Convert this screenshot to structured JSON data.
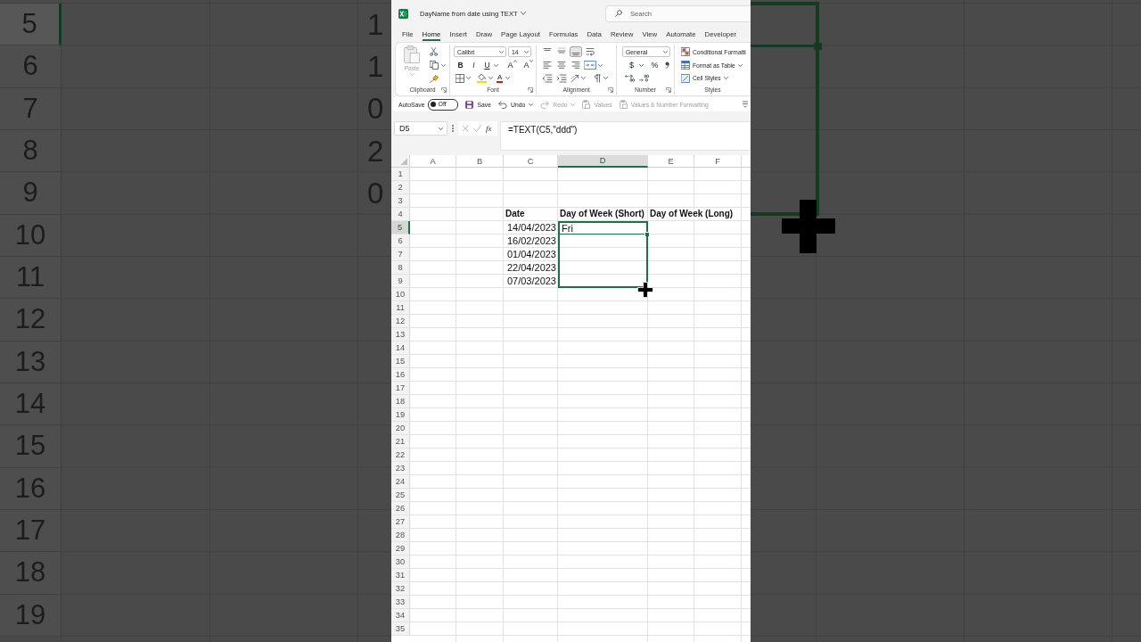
{
  "backdrop_left": {
    "row_headers": [
      {
        "label": "5",
        "selected": true
      },
      {
        "label": "6",
        "selected": false
      },
      {
        "label": "7",
        "selected": false
      },
      {
        "label": "8",
        "selected": false
      },
      {
        "label": "9",
        "selected": false
      },
      {
        "label": "10",
        "selected": false
      },
      {
        "label": "11",
        "selected": false
      },
      {
        "label": "12",
        "selected": false
      },
      {
        "label": "13",
        "selected": false
      },
      {
        "label": "14",
        "selected": false
      },
      {
        "label": "15",
        "selected": false
      },
      {
        "label": "16",
        "selected": false
      },
      {
        "label": "17",
        "selected": false
      },
      {
        "label": "18",
        "selected": false
      },
      {
        "label": "19",
        "selected": false
      }
    ],
    "cell_fragments": [
      "1",
      "1",
      "0",
      "2",
      "0"
    ]
  },
  "title_bar": {
    "file_name": "DayName from date using TEXT",
    "search_placeholder": "Search"
  },
  "ribbon_tabs": [
    {
      "label": "File",
      "selected": false
    },
    {
      "label": "Home",
      "selected": true
    },
    {
      "label": "Insert",
      "selected": false
    },
    {
      "label": "Draw",
      "selected": false
    },
    {
      "label": "Page Layout",
      "selected": false
    },
    {
      "label": "Formulas",
      "selected": false
    },
    {
      "label": "Data",
      "selected": false
    },
    {
      "label": "Review",
      "selected": false
    },
    {
      "label": "View",
      "selected": false
    },
    {
      "label": "Automate",
      "selected": false
    },
    {
      "label": "Developer",
      "selected": false
    }
  ],
  "ribbon": {
    "clipboard": {
      "paste_label": "Paste",
      "paste_disabled": true,
      "group_label": "Clipboard"
    },
    "font": {
      "font_name": "Calibri",
      "font_size": "14",
      "style_buttons": [
        {
          "kind": "bold",
          "label": "B"
        },
        {
          "kind": "italic",
          "label": "I"
        },
        {
          "kind": "underline",
          "label": "U"
        }
      ],
      "size_buttons": [
        {
          "kind": "grow",
          "label": "A"
        },
        {
          "kind": "shrink",
          "label": "A"
        }
      ],
      "font_color_label": "A",
      "group_label": "Font"
    },
    "alignment": {
      "vertical": [
        {
          "kind": "top",
          "selected": false
        },
        {
          "kind": "middle",
          "selected": false
        },
        {
          "kind": "bottom",
          "selected": true
        }
      ],
      "horizontal": [
        {
          "kind": "left",
          "selected": false
        },
        {
          "kind": "center",
          "selected": false
        },
        {
          "kind": "right",
          "selected": false
        }
      ],
      "group_label": "Alignment"
    },
    "number": {
      "format": "General",
      "currency_label": "$",
      "percent_label": "%",
      "group_label": "Number"
    },
    "styles": {
      "items": [
        {
          "kind": "conditional",
          "label": "Conditional Formatti"
        },
        {
          "kind": "table",
          "label": "Format as Table"
        },
        {
          "kind": "cell_styles",
          "label": "Cell Styles"
        }
      ],
      "group_label": "Styles"
    }
  },
  "quick_access": {
    "autosave_label": "AutoSave",
    "autosave_on": false,
    "autosave_state": "Off",
    "commands": [
      {
        "kind": "save",
        "label": "Save",
        "disabled": false
      },
      {
        "kind": "undo",
        "label": "Undo",
        "disabled": false
      },
      {
        "kind": "redo",
        "label": "Redo",
        "disabled": true
      },
      {
        "kind": "values",
        "label": "Values",
        "disabled": true
      },
      {
        "kind": "values_number",
        "label": "Values & Number Formatting",
        "disabled": true
      }
    ]
  },
  "formula_bar": {
    "name_box": "D5",
    "function_label": "fx",
    "formula": "=TEXT(C5,\"ddd\")"
  },
  "sheet": {
    "columns": [
      {
        "label": "A",
        "selected": false
      },
      {
        "label": "B",
        "selected": false
      },
      {
        "label": "C",
        "selected": false
      },
      {
        "label": "D",
        "selected": true
      },
      {
        "label": "E",
        "selected": false
      },
      {
        "label": "F",
        "selected": false
      }
    ],
    "rows": [
      {
        "label": "1",
        "kind": "empty",
        "selected": false,
        "in_fill_range": false
      },
      {
        "label": "2",
        "kind": "empty",
        "selected": false,
        "in_fill_range": false
      },
      {
        "label": "3",
        "kind": "empty",
        "selected": false,
        "in_fill_range": false
      },
      {
        "label": "4",
        "kind": "header",
        "selected": false,
        "in_fill_range": false,
        "date": "Date",
        "day_short": "Day of Week (Short)",
        "day_long": "Day of Week (Long)"
      },
      {
        "label": "5",
        "kind": "data",
        "selected": true,
        "in_fill_range": true,
        "date": "14/04/2023",
        "day_short": "Fri"
      },
      {
        "label": "6",
        "kind": "data",
        "selected": false,
        "in_fill_range": true,
        "date": "16/02/2023"
      },
      {
        "label": "7",
        "kind": "data",
        "selected": false,
        "in_fill_range": true,
        "date": "01/04/2023"
      },
      {
        "label": "8",
        "kind": "data",
        "selected": false,
        "in_fill_range": true,
        "date": "22/04/2023"
      },
      {
        "label": "9",
        "kind": "data",
        "selected": false,
        "in_fill_range": true,
        "date": "07/03/2023"
      },
      {
        "label": "10",
        "kind": "empty",
        "selected": false,
        "in_fill_range": false
      },
      {
        "label": "11",
        "kind": "empty",
        "selected": false,
        "in_fill_range": false
      },
      {
        "label": "12",
        "kind": "empty",
        "selected": false,
        "in_fill_range": false
      },
      {
        "label": "13",
        "kind": "empty",
        "selected": false,
        "in_fill_range": false
      },
      {
        "label": "14",
        "kind": "empty",
        "selected": false,
        "in_fill_range": false
      },
      {
        "label": "15",
        "kind": "empty",
        "selected": false,
        "in_fill_range": false
      },
      {
        "label": "16",
        "kind": "empty",
        "selected": false,
        "in_fill_range": false
      },
      {
        "label": "17",
        "kind": "empty",
        "selected": false,
        "in_fill_range": false
      },
      {
        "label": "18",
        "kind": "empty",
        "selected": false,
        "in_fill_range": false
      },
      {
        "label": "19",
        "kind": "empty",
        "selected": false,
        "in_fill_range": false
      },
      {
        "label": "20",
        "kind": "empty",
        "selected": false,
        "in_fill_range": false
      },
      {
        "label": "21",
        "kind": "empty",
        "selected": false,
        "in_fill_range": false
      },
      {
        "label": "22",
        "kind": "empty",
        "selected": false,
        "in_fill_range": false
      },
      {
        "label": "23",
        "kind": "empty",
        "selected": false,
        "in_fill_range": false
      },
      {
        "label": "24",
        "kind": "empty",
        "selected": false,
        "in_fill_range": false
      },
      {
        "label": "25",
        "kind": "empty",
        "selected": false,
        "in_fill_range": false
      },
      {
        "label": "26",
        "kind": "empty",
        "selected": false,
        "in_fill_range": false
      },
      {
        "label": "27",
        "kind": "empty",
        "selected": false,
        "in_fill_range": false
      },
      {
        "label": "28",
        "kind": "empty",
        "selected": false,
        "in_fill_range": false
      },
      {
        "label": "29",
        "kind": "empty",
        "selected": false,
        "in_fill_range": false
      },
      {
        "label": "30",
        "kind": "empty",
        "selected": false,
        "in_fill_range": false
      },
      {
        "label": "31",
        "kind": "empty",
        "selected": false,
        "in_fill_range": false
      },
      {
        "label": "32",
        "kind": "empty",
        "selected": false,
        "in_fill_range": false
      },
      {
        "label": "33",
        "kind": "empty",
        "selected": false,
        "in_fill_range": false
      },
      {
        "label": "34",
        "kind": "empty",
        "selected": false,
        "in_fill_range": false
      },
      {
        "label": "35",
        "kind": "empty",
        "selected": false,
        "in_fill_range": false
      }
    ]
  }
}
